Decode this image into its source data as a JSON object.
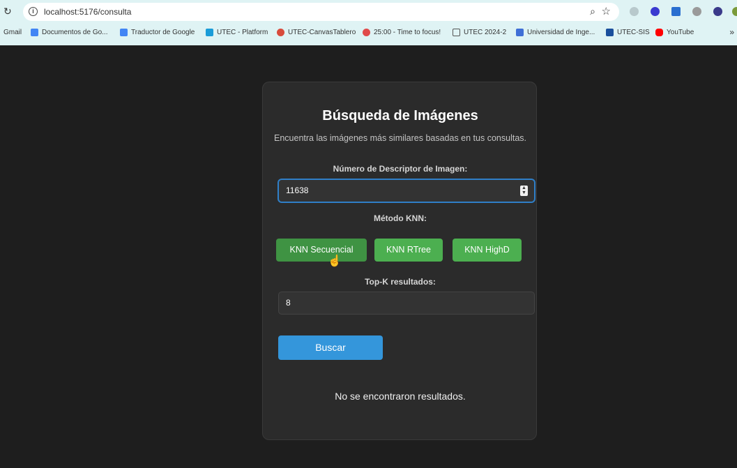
{
  "browser": {
    "url": "localhost:5176/consulta",
    "bookmarks": [
      {
        "label": "Gmail",
        "color": "#e44134"
      },
      {
        "label": "Documentos de Go...",
        "color": "#4285f4"
      },
      {
        "label": "Traductor de Google",
        "color": "#4285f4"
      },
      {
        "label": "UTEC - Platform",
        "color": "#1a9cd8"
      },
      {
        "label": "UTEC-CanvasTablero",
        "color": "#d84b3c"
      },
      {
        "label": "25:00 - Time to focus!",
        "color": "#e04a4a"
      },
      {
        "label": "UTEC 2024-2",
        "color": "#555555"
      },
      {
        "label": "Universidad de Inge...",
        "color": "#3f6fd6"
      },
      {
        "label": "UTEC-SIS",
        "color": "#1a4f9c"
      },
      {
        "label": "YouTube",
        "color": "#ff0000"
      }
    ]
  },
  "page": {
    "title": "Búsqueda de Imágenes",
    "subtitle": "Encuentra las imágenes más similares basadas en tus consultas.",
    "descriptor_label": "Número de Descriptor de Imagen:",
    "descriptor_value": "11638",
    "method_label": "Método KNN:",
    "methods": [
      "KNN Secuencial",
      "KNN RTree",
      "KNN HighD"
    ],
    "topk_label": "Top-K resultados:",
    "topk_value": "8",
    "search_button": "Buscar",
    "no_results": "No se encontraron resultados."
  },
  "colors": {
    "background": "#1e1e1e",
    "card": "#2b2b2b",
    "knn_button": "#4caf50",
    "search_button": "#3496db"
  }
}
